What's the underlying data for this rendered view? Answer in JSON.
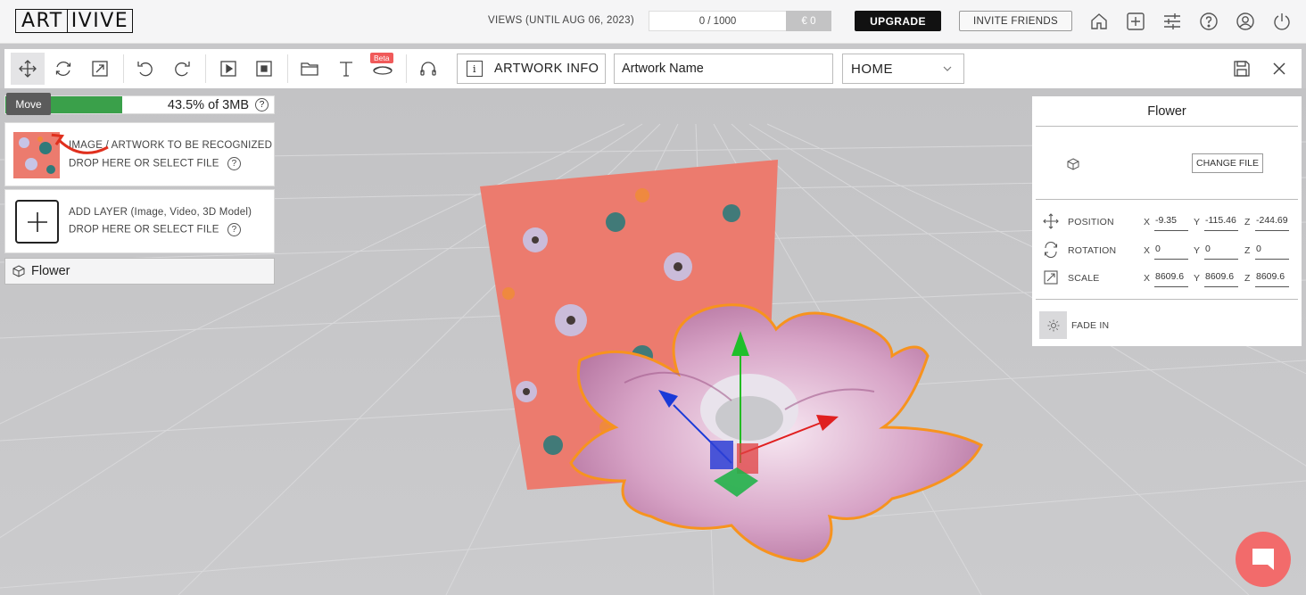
{
  "header": {
    "logo_left": "ART",
    "logo_right": "IVIVE",
    "views_label": "VIEWS (UNTIL AUG 06, 2023)",
    "views_count": "0 / 1000",
    "balance": "€ 0",
    "upgrade_label": "UPGRADE",
    "invite_label": "INVITE FRIENDS",
    "icons": [
      "home-icon",
      "add-icon",
      "sliders-icon",
      "help-icon",
      "account-icon",
      "power-icon"
    ]
  },
  "toolbar": {
    "tools": [
      "move-icon",
      "rotate-icon",
      "scale-icon",
      "undo-icon",
      "redo-icon",
      "play-icon",
      "stop-icon",
      "folder-icon",
      "text-icon",
      "portal-icon",
      "audio-icon"
    ],
    "beta_badge": "Beta",
    "artwork_info_label": "ARTWORK INFO",
    "info_glyph": "i",
    "artwork_name_value": "Artwork Name",
    "scene_select": "HOME",
    "active_tool": "move"
  },
  "tooltip": "Move",
  "storage": {
    "used_fraction": 0.435,
    "label": "43.5% of 3MB"
  },
  "left_panel": {
    "artwork_card": {
      "line1": "IMAGE / ARTWORK TO BE RECOGNIZED",
      "line2": "DROP HERE OR SELECT FILE"
    },
    "layer_card": {
      "line1": "ADD LAYER (Image, Video, 3D Model)",
      "line2": "DROP HERE OR SELECT FILE"
    },
    "help_glyph": "?",
    "layers": [
      {
        "name": "Flower"
      }
    ]
  },
  "properties": {
    "title": "Flower",
    "change_file_label": "CHANGE FILE",
    "position": {
      "label": "POSITION",
      "x": "-9.35",
      "y": "-115.46",
      "z": "-244.69"
    },
    "rotation": {
      "label": "ROTATION",
      "x": "0",
      "y": "0",
      "z": "0"
    },
    "scale": {
      "label": "SCALE",
      "x": "8609.6",
      "y": "8609.6",
      "z": "8609.6"
    },
    "axis_x": "X",
    "axis_y": "Y",
    "axis_z": "Z",
    "fade_label": "FADE IN"
  },
  "colors": {
    "accent": "#3aa04a",
    "artwork_bg": "#ec7b6e",
    "chat": "#f26b6b",
    "outline": "#f7931e"
  }
}
